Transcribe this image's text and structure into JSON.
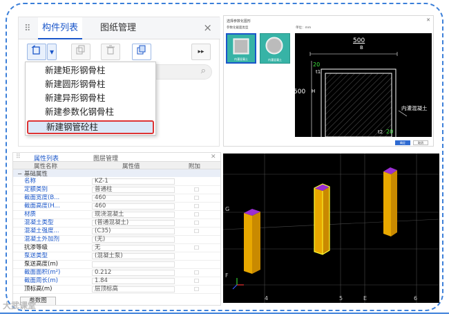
{
  "left_top_panel": {
    "tabs": [
      "构件列表",
      "图纸管理"
    ],
    "close": "×",
    "toolbar_more": "▸▸",
    "new_menu": [
      "新建矩形钢骨柱",
      "新建圆形钢骨柱",
      "新建异形钢骨柱",
      "新建参数化钢骨柱",
      "新建钢管砼柱"
    ]
  },
  "dialog": {
    "title": "选择参数化图形",
    "tab_label": "参数化截面类型",
    "unit_label": "单位：mm",
    "thumb_labels": [
      "内灌混凝土",
      "内灌混凝土"
    ],
    "dim_top": "500",
    "dim_b": "B",
    "dim_left": "500",
    "dim_h": "H",
    "dim_t1_value": "20",
    "dim_t1": "t1",
    "dim_t2": "t2",
    "dim_t2_value": "20",
    "inner_label": "内灌混凝土",
    "ok": "确定",
    "cancel": "取消"
  },
  "properties": {
    "tabs": [
      "属性列表",
      "图层管理"
    ],
    "headers": [
      "属性名称",
      "属性值",
      "附加"
    ],
    "group": "基础属性",
    "rows": [
      {
        "name": "名称",
        "value": "KZ-1",
        "style": "blue",
        "extra": ""
      },
      {
        "name": "定额类别",
        "value": "普通柱",
        "style": "blue",
        "extra": "☐"
      },
      {
        "name": "截面宽度(B...",
        "value": "460",
        "style": "blue",
        "extra": "☐"
      },
      {
        "name": "截面高度(H...",
        "value": "460",
        "style": "blue",
        "extra": "☐"
      },
      {
        "name": "材质",
        "value": "现浇混凝土",
        "style": "blue",
        "extra": "☐"
      },
      {
        "name": "混凝土类型",
        "value": "(普通混凝土)",
        "style": "blue",
        "extra": "☐"
      },
      {
        "name": "混凝土强度...",
        "value": "(C35)",
        "style": "blue",
        "extra": "☐"
      },
      {
        "name": "混凝土外加剂",
        "value": "(无)",
        "style": "blue",
        "extra": ""
      },
      {
        "name": "抗渗等级",
        "value": "无",
        "style": "dark",
        "extra": "☐"
      },
      {
        "name": "泵送类型",
        "value": "(混凝土泵)",
        "style": "blue",
        "extra": ""
      },
      {
        "name": "泵送高度(m)",
        "value": "",
        "style": "dark",
        "extra": ""
      },
      {
        "name": "截面面积(m²)",
        "value": "0.212",
        "style": "blue",
        "extra": "☐"
      },
      {
        "name": "截面周长(m)",
        "value": "1.84",
        "style": "blue",
        "extra": "☐"
      },
      {
        "name": "顶标高(m)",
        "value": "层顶标高",
        "style": "dark",
        "extra": "☐"
      }
    ],
    "param_button": "参数图"
  },
  "view3d": {
    "axis_labels": [
      "G",
      "F"
    ],
    "grid_labels": [
      "4",
      "5",
      "E",
      "6"
    ]
  },
  "watermark": "大武课堂",
  "colors": {
    "accent": "#1a56c9",
    "column": "#e8a800",
    "column_top": "#9b2fd3",
    "highlight": "#d33"
  }
}
